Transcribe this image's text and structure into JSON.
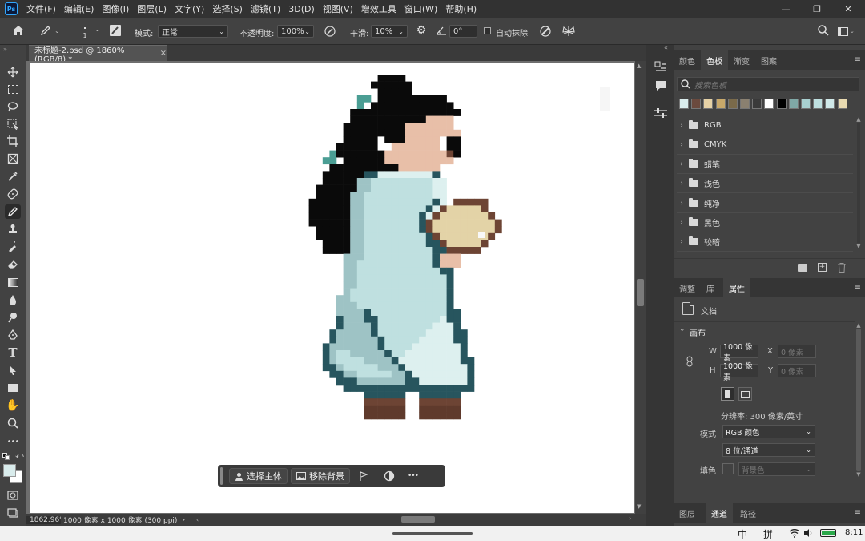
{
  "menubar": {
    "logo": "Ps",
    "items": [
      "文件(F)",
      "编辑(E)",
      "图像(I)",
      "图层(L)",
      "文字(Y)",
      "选择(S)",
      "滤镜(T)",
      "3D(D)",
      "视图(V)",
      "增效工具",
      "窗口(W)",
      "帮助(H)"
    ],
    "controls": {
      "minimize": "—",
      "restore": "❐",
      "close": "✕"
    }
  },
  "options": {
    "brush_size": "1",
    "mode_label": "模式:",
    "mode_value": "正常",
    "opacity_label": "不透明度:",
    "opacity_value": "100%",
    "smoothing_label": "平滑:",
    "smoothing_value": "10%",
    "angle_value": "0°",
    "auto_erase_label": "自动抹除"
  },
  "document": {
    "tab_title": "未标题-2.psd @ 1860%(RGB/8) *",
    "tab_close": "×"
  },
  "status": {
    "zoom": "1862.96%",
    "info": "1000 像素 x 1000 像素 (300 ppi)",
    "arrow": "›"
  },
  "context_bar": {
    "select_subject": "选择主体",
    "remove_bg": "移除背景",
    "more": "•••"
  },
  "swatches_panel": {
    "tabs": [
      "颜色",
      "色板",
      "渐变",
      "图案"
    ],
    "active_tab": "色板",
    "search_placeholder": "搜索色板",
    "swatch_colors": [
      "#d9ecec",
      "#6b4a3e",
      "#e6d2a6",
      "#c9a96a",
      "#7a6a4a",
      "#8a8070",
      "#3a3a3a",
      "#ffffff",
      "#000000",
      "#7fa8a6",
      "#a8d0d0",
      "#bfe0e0",
      "#d0e9e9",
      "#e8dab0"
    ],
    "groups": [
      "RGB",
      "CMYK",
      "蜡笔",
      "浅色",
      "纯净",
      "黑色",
      "较暗"
    ]
  },
  "properties_panel": {
    "tabs": [
      "调整",
      "库",
      "属性"
    ],
    "active_tab": "属性",
    "doc_label": "文档",
    "section": "画布",
    "w_label": "W",
    "w_value": "1000 像素",
    "h_label": "H",
    "h_value": "1000 像素",
    "x_label": "X",
    "x_placeholder": "0 像素",
    "y_label": "Y",
    "y_placeholder": "0 像素",
    "resolution": "分辨率: 300 像素/英寸",
    "mode_label": "模式",
    "mode_value": "RGB 颜色",
    "depth_value": "8 位/通道",
    "fill_label": "填色",
    "fill_value": "背景色"
  },
  "layers_panel": {
    "tabs": [
      "图层",
      "通道",
      "路径"
    ],
    "active_tab": "通道"
  },
  "taskbar": {
    "ime_zh": "中",
    "ime_pinyin": "拼",
    "time": "8:11"
  },
  "colors": {
    "foreground": "#d9ecec",
    "background": "#ffffff",
    "accent": "#31a8ff"
  },
  "pixel_art": {
    "palette": {
      "k": "#0a0a0a",
      "T": "#4b9e94",
      "s": "#e8bfa8",
      "e": "#ffffff",
      "D": "#27555e",
      "M": "#9ec3c5",
      "L": "#bfe0e0",
      "W": "#ddf0ef",
      "B": "#6d4434",
      "F": "#e3d3a7",
      "Q": "#5f3a2c",
      "g": "#f4f4f4"
    },
    "rows": [
      "...........kkkk.............",
      "..........kkkkkk............",
      "...........kkkkk............",
      "........TT.kkkkkkkkkk.......",
      "........T.kkkkkkkkkkkk......",
      ".......kkkkkkkkkkkkkkkk.....",
      ".......kkkkkkkkkkkssss......",
      "......kkkkkkkkksssssss......",
      "......kkkkkkkkkssssssss.....",
      "......kkkkkekkksssssekk.....",
      ".....kkkkkkeesssssssekk.....",
      "....TkkkkkkksssssssssBk.....",
      "...TT.kkkkkkssssssssss......",
      "....kkkkkkkkkkssssss........",
      "...kkkkkkDDWWWWWWWWD........",
      "...kkkkkMMLLLLLLLLLWW.......",
      "..kkkkkkMMLLLLLLLLLWW.......",
      "..kkkkkMMLLLLLLLLLLWW.......",
      ".kkkkkkMMLLLLLLLLLLDW.BBBBB..",
      ".kkkkkkMMLLLLLLLLLDWBFFFFFB.",
      ".kkkkkkMMLLLLLLLLDWBFFFFFFFB",
      ".kkkkkkMMLLLLLLLLDBFFFFFFFFFB",
      "..kkkkkMMLLLLLLLLDBFFFFFFFFFB",
      "..kkkkkMMLLLLLLLLLDBFFFFFFFB.",
      "...kkkkMMLLLLLLLLLDDBFFFFFB..",
      "...kkkkMMLLLLLLLLLLDDBBBBB...",
      "......MMMLLLLLLLLLLDsss......",
      "......MMLLLLLLLLLLLDsss......",
      "......MMLLLLLLLLLLLLDD.......",
      "......MMLLLLLLLLLLLLLD.......",
      "......MMLLLLLLLLLLLLLD.......",
      "......MLLLLLLLLLLLLLLD.......",
      ".....MMLLLLLLLLLLLLLLD.......",
      ".....MMMLLLLLLLLLLLLLD.......",
      ".....MMMMDLLLLLLLLLLLDD......",
      ".....DMMMDDLLLLLLLLLWDD......",
      ".....DMMMMDLLLLLLLLWWWD......",
      "....DMMMMMDLLLLLLLWWWWDD.....",
      "....DMMMMMMDLLLLLWWWWWDD.....",
      "...DMMMMMMMDLLLLWWWWWWWD.....",
      "...DMLLMMMMMDLLWWWWWWWWD.....",
      "...DMLLLLMMMMDWWWWWWWWWDD....",
      "...DDMLLLLLMMMDWWWWWWWWWD....",
      "....DDMMLLLLLMMDWWWWWWWWD....",
      ".....DDDMMMMMMMDDWWWWWWWD....",
      "......DDDDDDDDDDDDDDDDDDD....",
      ".........DDDDDD..DDDDDD......",
      ".........BBBBBB..BBBBBB......",
      ".........QQQQQQ..QQQQQQ......",
      ".........QQQQQQ..QQQQQQ......"
    ]
  }
}
